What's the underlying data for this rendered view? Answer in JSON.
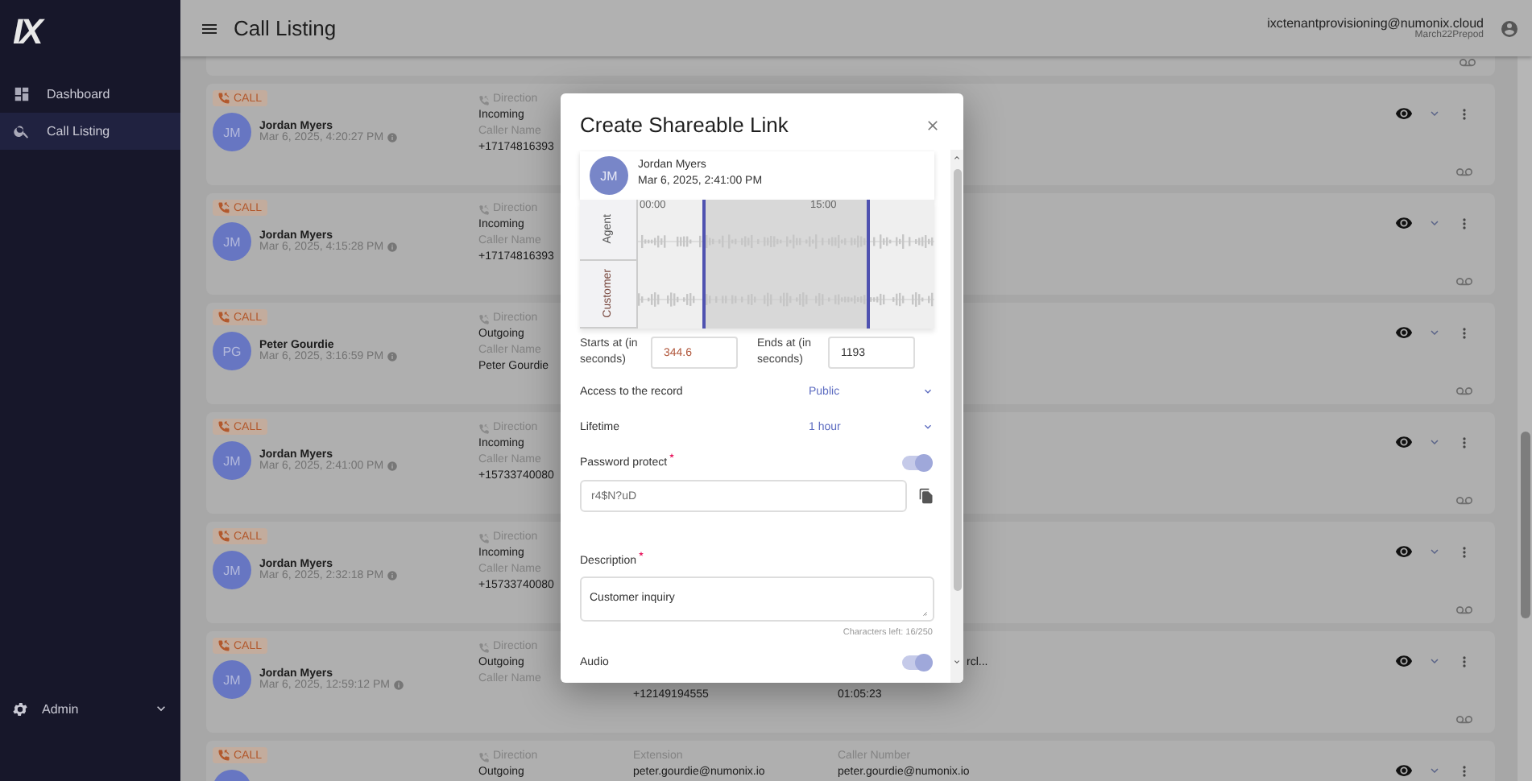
{
  "sidebar": {
    "logo": "IX",
    "items": [
      {
        "label": "Dashboard",
        "selected": false
      },
      {
        "label": "Call Listing",
        "selected": true
      }
    ],
    "footer": {
      "label": "Admin",
      "expanded": false
    }
  },
  "header": {
    "title": "Call Listing",
    "user": "ixctenantprovisioning@numonix.cloud",
    "tenant": "March22Prepod"
  },
  "cards": [
    {
      "badge": "CALL",
      "initials": "JM",
      "name": "Jordan Myers",
      "time": "Mar 6, 2025, 4:20:27 PM",
      "columns": [
        [
          {
            "kind": "direction-label",
            "text": "Direction"
          },
          {
            "kind": "value",
            "text": "Incoming"
          },
          {
            "kind": "label",
            "text": "Caller Name"
          },
          {
            "kind": "value",
            "text": "+17174816393"
          }
        ]
      ]
    },
    {
      "badge": "CALL",
      "initials": "JM",
      "name": "Jordan Myers",
      "time": "Mar 6, 2025, 4:15:28 PM",
      "columns": [
        [
          {
            "kind": "direction-label",
            "text": "Direction"
          },
          {
            "kind": "value",
            "text": "Incoming"
          },
          {
            "kind": "label",
            "text": "Caller Name"
          },
          {
            "kind": "value",
            "text": "+17174816393"
          }
        ]
      ]
    },
    {
      "badge": "CALL",
      "initials": "PG",
      "name": "Peter Gourdie",
      "time": "Mar 6, 2025, 3:16:59 PM",
      "columns": [
        [
          {
            "kind": "direction-label",
            "text": "Direction"
          },
          {
            "kind": "value",
            "text": "Outgoing"
          },
          {
            "kind": "label",
            "text": "Caller Name"
          },
          {
            "kind": "value",
            "text": "Peter Gourdie"
          }
        ]
      ]
    },
    {
      "badge": "CALL",
      "initials": "JM",
      "name": "Jordan Myers",
      "time": "Mar 6, 2025, 2:41:00 PM",
      "columns": [
        [
          {
            "kind": "direction-label",
            "text": "Direction"
          },
          {
            "kind": "value",
            "text": "Incoming"
          },
          {
            "kind": "label",
            "text": "Caller Name"
          },
          {
            "kind": "value",
            "text": "+15733740080"
          }
        ]
      ]
    },
    {
      "badge": "CALL",
      "initials": "JM",
      "name": "Jordan Myers",
      "time": "Mar 6, 2025, 2:32:18 PM",
      "columns": [
        [
          {
            "kind": "direction-label",
            "text": "Direction"
          },
          {
            "kind": "value",
            "text": "Incoming"
          },
          {
            "kind": "label",
            "text": "Caller Name"
          },
          {
            "kind": "value",
            "text": "+15733740080"
          }
        ]
      ]
    },
    {
      "badge": "CALL",
      "initials": "JM",
      "name": "Jordan Myers",
      "time": "Mar 6, 2025, 12:59:12 PM",
      "columns": [
        [
          {
            "kind": "direction-label",
            "text": "Direction"
          },
          {
            "kind": "value",
            "text": "Outgoing"
          },
          {
            "kind": "label",
            "text": "Caller Name"
          },
          null
        ],
        [
          null,
          null,
          null,
          {
            "kind": "value",
            "text": "+12149194555"
          }
        ],
        [
          null,
          null,
          null,
          {
            "kind": "value",
            "text": "01:05:23"
          }
        ],
        [
          null,
          {
            "kind": "value",
            "text": "rcl..."
          }
        ]
      ]
    },
    {
      "badge": "CALL",
      "columns": [
        [
          {
            "kind": "direction-label",
            "text": "Direction"
          },
          {
            "kind": "value",
            "text": "Outgoing"
          }
        ],
        [
          {
            "kind": "label",
            "text": "Extension"
          },
          {
            "kind": "value",
            "text": "peter.gourdie@numonix.io"
          }
        ],
        [
          {
            "kind": "label",
            "text": "Caller Number"
          },
          {
            "kind": "value",
            "text": "peter.gourdie@numonix.io"
          }
        ]
      ]
    }
  ],
  "dialog": {
    "title": "Create Shareable Link",
    "call": {
      "initials": "JM",
      "name": "Jordan Myers",
      "time": "Mar 6, 2025, 2:41:00 PM"
    },
    "waveform": {
      "tracks": [
        "Agent",
        "Customer"
      ],
      "ticks": [
        "00:00",
        "15:00"
      ]
    },
    "range": [
      {
        "label": "Starts at (in seconds)",
        "value": "344.6"
      },
      {
        "label": "Ends at (in seconds)",
        "value": "1193"
      }
    ],
    "settings": [
      {
        "kind": "select",
        "label": "Access to the record",
        "value": "Public"
      },
      {
        "kind": "select",
        "label": "Lifetime",
        "value": "1 hour"
      },
      {
        "kind": "toggle",
        "label": "Password protect",
        "required": true,
        "on": true
      },
      {
        "kind": "password",
        "value": "r4$N?uD"
      },
      {
        "kind": "textarea",
        "label": "Description",
        "required": true,
        "value": "Customer inquiry",
        "counter": "Characters left: 16/250"
      },
      {
        "kind": "toggle",
        "label": "Audio",
        "required": false,
        "on": true
      }
    ]
  }
}
